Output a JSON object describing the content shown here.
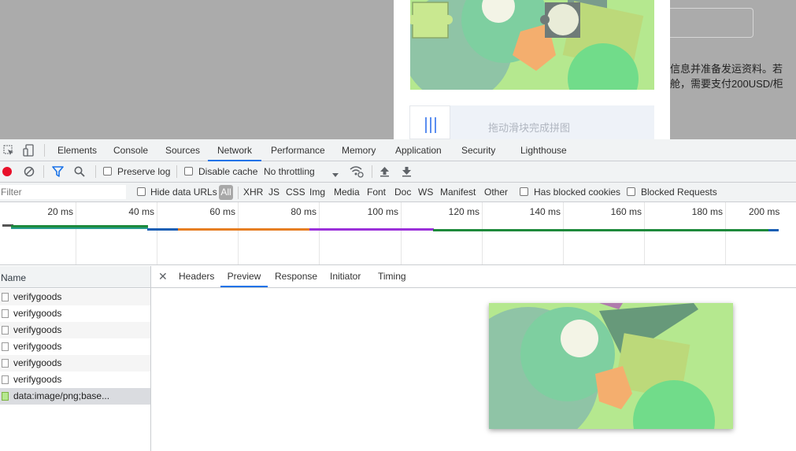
{
  "page": {
    "slider_hint": "拖动滑块完成拼图",
    "bg_text_line1": "信息并准备发运资料。若",
    "bg_text_line2": "舱，需要支付200USD/柜"
  },
  "devtools": {
    "tabs": [
      "Elements",
      "Console",
      "Sources",
      "Network",
      "Performance",
      "Memory",
      "Application",
      "Security",
      "Lighthouse"
    ],
    "active_tab": "Network",
    "toolbar": {
      "preserve_log": "Preserve log",
      "disable_cache": "Disable cache",
      "throttling": "No throttling"
    },
    "filter": {
      "placeholder": "Filter",
      "hide_data_urls": "Hide data URLs",
      "types": [
        "All",
        "XHR",
        "JS",
        "CSS",
        "Img",
        "Media",
        "Font",
        "Doc",
        "WS",
        "Manifest",
        "Other"
      ],
      "has_blocked_cookies": "Has blocked cookies",
      "blocked_requests": "Blocked Requests"
    },
    "timeline_ticks": [
      "20 ms",
      "40 ms",
      "60 ms",
      "80 ms",
      "100 ms",
      "120 ms",
      "140 ms",
      "160 ms",
      "180 ms",
      "200 ms"
    ],
    "requests": {
      "header": "Name",
      "items": [
        "verifygoods",
        "verifygoods",
        "verifygoods",
        "verifygoods",
        "verifygoods",
        "verifygoods",
        "data:image/png;base..."
      ]
    },
    "detail_tabs": [
      "Headers",
      "Preview",
      "Response",
      "Initiator",
      "Timing"
    ],
    "active_detail_tab": "Preview"
  },
  "colors": {
    "accent": "#1a73e8",
    "record": "#e8102a",
    "puzzle_bg": "#b5e88f"
  }
}
